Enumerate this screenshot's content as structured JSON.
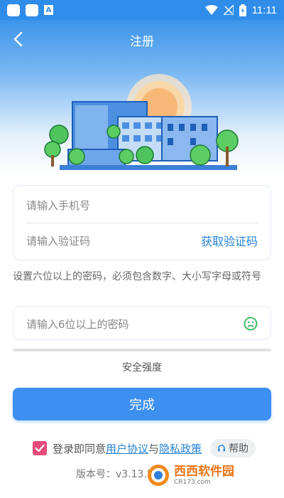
{
  "status_bar": {
    "time": "11:11",
    "a_icon_text": "A"
  },
  "header": {
    "title": "注册"
  },
  "form": {
    "phone_placeholder": "请输入手机号",
    "code_placeholder": "请输入验证码",
    "get_code_label": "获取验证码",
    "password_hint": "设置六位以上的密码，必须包含数字、大小写字母或符号",
    "password_placeholder": "请输入6位以上的密码",
    "strength_label": "安全强度",
    "submit_label": "完成"
  },
  "agreement": {
    "prefix": "登录即同意",
    "user_agreement": "用户协议",
    "and": "与",
    "privacy_policy": "隐私政策",
    "checked": true
  },
  "help_label": "帮助",
  "version_text": "版本号：v3.13.5",
  "watermark": {
    "brand": "西西软件园",
    "domain": "CR173.com"
  },
  "colors": {
    "primary": "#3d8ff0",
    "link": "#2683d6",
    "checkbox": "#e84b7a",
    "smile": "#2fb35a"
  }
}
